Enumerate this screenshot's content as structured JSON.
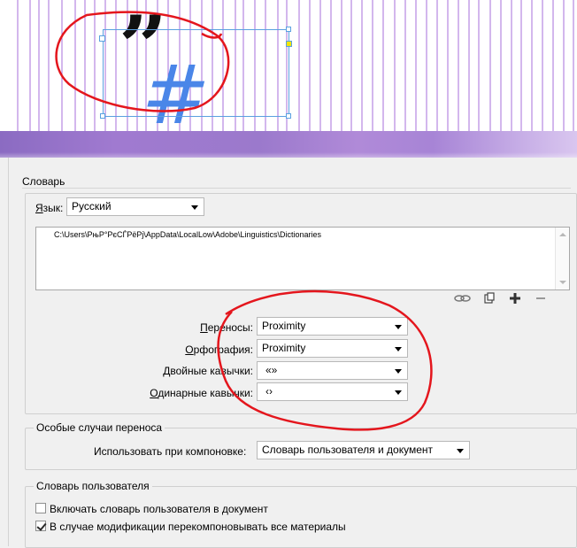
{
  "canvas": {
    "quote_glyph": "”",
    "hash_glyph": "#"
  },
  "section_dictionary": {
    "title": "Словарь",
    "language_label_prefix": "",
    "language_label_underlined": "Я",
    "language_label_rest": "зык:",
    "language_value": "Русский",
    "dictionary_path": "C:\\Users\\РњР°РєСЃРёРј\\AppData\\LocalLow\\Adobe\\Linguistics\\Dictionaries",
    "hyphenation_label_underlined": "П",
    "hyphenation_label_rest": "ереносы:",
    "hyphenation_value": "Proximity",
    "spelling_label_underlined": "О",
    "spelling_label_rest": "рфография:",
    "spelling_value": "Proximity",
    "double_quotes_label_underlined": "Д",
    "double_quotes_label_rest": "войные кавычки:",
    "double_quotes_value": "«»",
    "single_quotes_label_underlined": "О",
    "single_quotes_label_rest": "динарные кавычки:",
    "single_quotes_value": "‹›"
  },
  "section_hyphen_exceptions": {
    "title": "Особые случаи переноса",
    "compose_using_label": "Использовать при компоновке:",
    "compose_using_value": "Словарь пользователя и документ"
  },
  "section_user_dictionary": {
    "title": "Словарь пользователя",
    "merge_label": "Включать словарь пользователя в документ",
    "merge_checked": false,
    "recompose_label": "В случае модификации перекомпоновывать все материалы",
    "recompose_checked": true
  },
  "icons": {
    "relink": "link-icon",
    "new_dict": "new-dictionary-icon",
    "add": "add-icon",
    "remove": "remove-icon"
  },
  "colors": {
    "guide_lines": "#8a3fd0",
    "annotation": "#e4161d",
    "hash": "#4a86e8",
    "banner": "#a07ad0",
    "anchor": "#f2e600"
  }
}
